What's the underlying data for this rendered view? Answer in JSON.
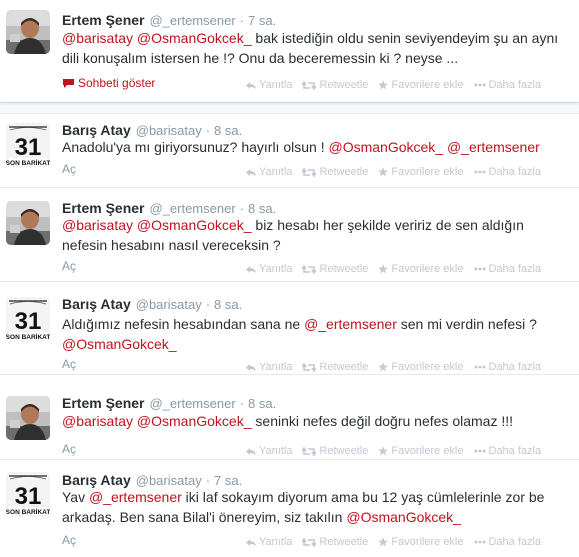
{
  "accent_color": "#c0131e",
  "actions": {
    "reply": "Yanıtla",
    "retweet": "Retweetle",
    "favorite": "Favorilere ekle",
    "more": "Daha fazla"
  },
  "tweets": [
    {
      "author": "Ertem Şener",
      "handle": "@_ertemsener",
      "time": "7 sa.",
      "avatar": "ertem-avatar",
      "lines": [
        [
          {
            "m": "@barisatay"
          },
          {
            "t": " "
          },
          {
            "m": "@OsmanGokcek_"
          },
          {
            "t": " bak istediğin oldu senin seviyendeyim şu an aynı"
          }
        ],
        [
          {
            "t": "dili konuşalım istersen he !? Onu da beceremessin ki ? neyse ..."
          }
        ]
      ],
      "footer": "Sohbeti göster"
    },
    {
      "author": "Barış Atay",
      "handle": "@barisatay",
      "time": "8 sa.",
      "avatar": "baris-avatar",
      "lines": [
        [
          {
            "t": "Anadolu'ya mı giriyorsunuz? hayırlı olsun ! "
          },
          {
            "m": "@OsmanGokcek_"
          },
          {
            "t": " "
          },
          {
            "m": "@_ertemsener"
          }
        ]
      ],
      "footer": "Aç"
    },
    {
      "author": "Ertem Şener",
      "handle": "@_ertemsener",
      "time": "8 sa.",
      "avatar": "ertem-avatar",
      "lines": [
        [
          {
            "m": "@barisatay"
          },
          {
            "t": " "
          },
          {
            "m": "@OsmanGokcek_"
          },
          {
            "t": " biz hesabı her şekilde veririz de sen aldığın"
          }
        ],
        [
          {
            "t": "nefesin hesabını nasıl vereceksin ?"
          }
        ]
      ],
      "footer": "Aç"
    },
    {
      "author": "Barış Atay",
      "handle": "@barisatay",
      "time": "8 sa.",
      "avatar": "baris-avatar",
      "lines": [
        [
          {
            "t": "Aldığımız nefesin hesabından sana ne "
          },
          {
            "m": "@_ertemsener"
          },
          {
            "t": " sen mi verdin nefesi ?"
          }
        ],
        [
          {
            "m": "@OsmanGokcek_"
          }
        ]
      ],
      "footer": "Aç"
    },
    {
      "author": "Ertem Şener",
      "handle": "@_ertemsener",
      "time": "8 sa.",
      "avatar": "ertem-avatar",
      "lines": [
        [
          {
            "m": "@barisatay"
          },
          {
            "t": " "
          },
          {
            "m": "@OsmanGokcek_"
          },
          {
            "t": " seninki nefes değil doğru nefes olamaz !!!"
          }
        ]
      ],
      "footer": "Aç"
    },
    {
      "author": "Barış Atay",
      "handle": "@barisatay",
      "time": "7 sa.",
      "avatar": "baris-avatar",
      "lines": [
        [
          {
            "t": "Yav "
          },
          {
            "m": "@_ertemsener"
          },
          {
            "t": " iki laf sokayım diyorum ama bu 12 yaş cümlelerinle zor be"
          }
        ],
        [
          {
            "t": "arkadaş. Ben sana Bilal'i önereyim, siz takılın "
          },
          {
            "m": "@OsmanGokcek_"
          }
        ]
      ],
      "footer": "Aç"
    }
  ]
}
